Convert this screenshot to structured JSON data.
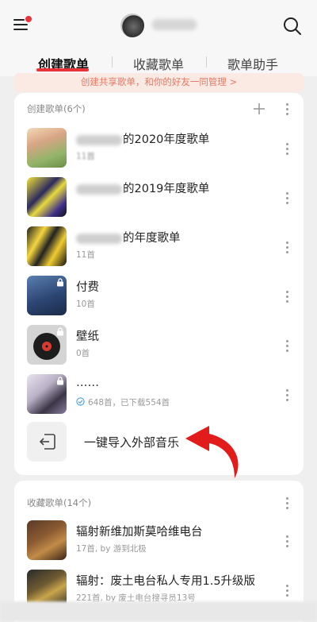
{
  "header": {
    "menu_icon": "menu-icon",
    "search_icon": "search-icon",
    "notification_color": "#e8333a"
  },
  "tabs": [
    {
      "label": "创建歌单",
      "active": true
    },
    {
      "label": "收藏歌单",
      "active": false
    },
    {
      "label": "歌单助手",
      "active": false
    }
  ],
  "banner": {
    "text": "创建共享歌单，和你的好友一同管理 >"
  },
  "created_section": {
    "title": "创建歌单(6个)",
    "items": [
      {
        "title_suffix": "的2020年度歌单",
        "subtitle": "11首",
        "locked": false
      },
      {
        "title_suffix": "的2019年度歌单",
        "subtitle": "",
        "locked": false
      },
      {
        "title_suffix": "的年度歌单",
        "subtitle": "11首",
        "locked": false
      },
      {
        "title": "付费",
        "subtitle": "10首",
        "locked": true
      },
      {
        "title": "壁纸",
        "subtitle": "0首",
        "locked": true
      },
      {
        "title": "……",
        "subtitle": "648首，已下载554首",
        "locked": true
      }
    ],
    "import_label": "一键导入外部音乐"
  },
  "collected_section": {
    "title": "收藏歌单(14个)",
    "items": [
      {
        "title": "辐射新维加斯莫哈维电台",
        "subtitle": "17首, by 游到北极"
      },
      {
        "title": "辐射：废土电台私人专用1.5升级版",
        "subtitle": "221首, by 废土电台搜寻员13号"
      }
    ]
  },
  "accent_color": "#e8333a"
}
